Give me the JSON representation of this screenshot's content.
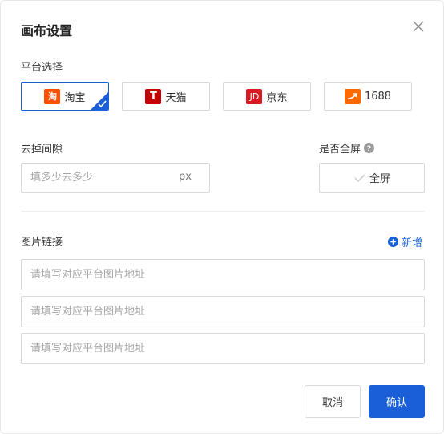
{
  "dialog": {
    "title": "画布设置",
    "close_icon": "close-icon"
  },
  "platform": {
    "label": "平台选择",
    "options": [
      {
        "name": "淘宝",
        "logo_text": "淘",
        "color": "#ff5000",
        "selected": true
      },
      {
        "name": "天猫",
        "logo_text": "T",
        "color": "#c40000",
        "selected": false
      },
      {
        "name": "京东",
        "logo_text": "JD",
        "color": "#d71a20",
        "selected": false
      },
      {
        "name": "1688",
        "logo_text": "",
        "color": "#ff6a00",
        "selected": false
      }
    ]
  },
  "gap": {
    "label": "去掉间隙",
    "placeholder": "填多少去多少",
    "value": "",
    "unit": "px"
  },
  "fullscreen": {
    "label": "是否全屏",
    "help_icon": "question-circle-icon",
    "button_label": "全屏",
    "checked": false
  },
  "images": {
    "label": "图片链接",
    "add_label": "新增",
    "inputs": [
      {
        "placeholder": "请填写对应平台图片地址",
        "value": ""
      },
      {
        "placeholder": "请填写对应平台图片地址",
        "value": ""
      },
      {
        "placeholder": "请填写对应平台图片地址",
        "value": ""
      }
    ]
  },
  "footer": {
    "cancel_label": "取消",
    "confirm_label": "确认"
  },
  "colors": {
    "primary": "#1a5ed8",
    "border": "#d9d9d9"
  }
}
